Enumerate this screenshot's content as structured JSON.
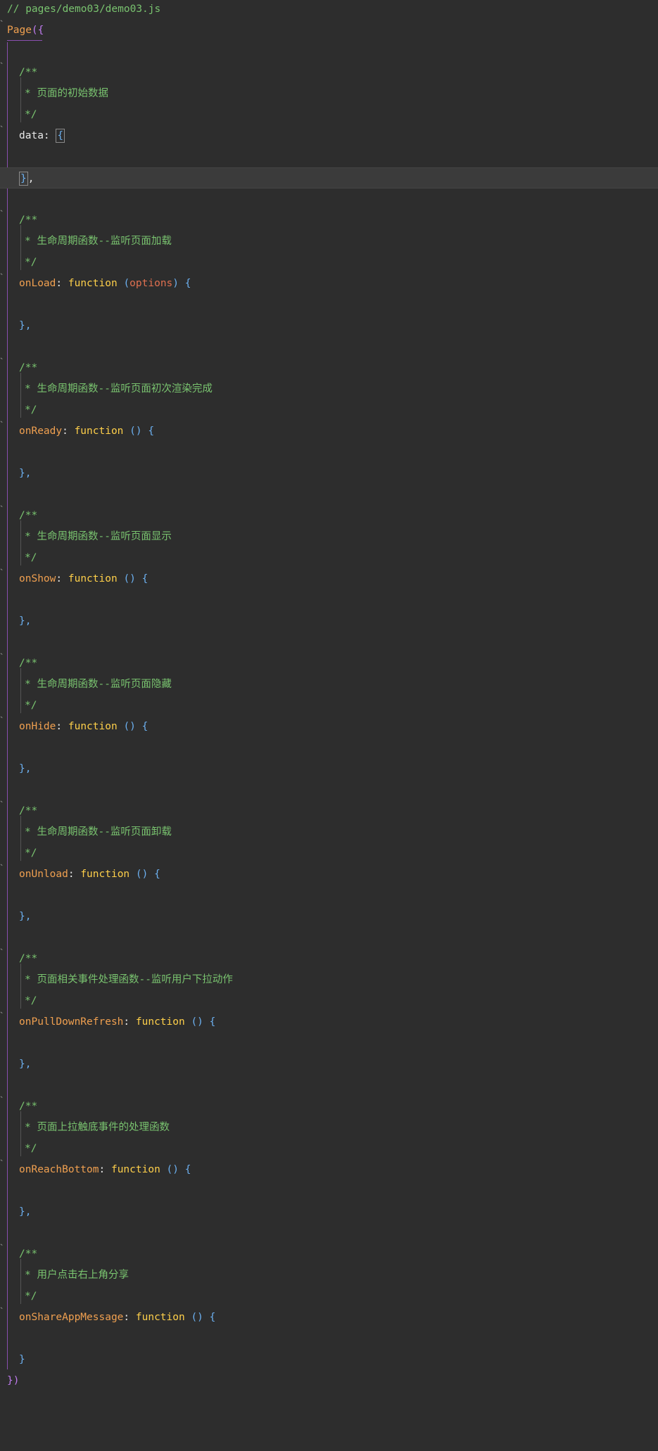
{
  "editor": {
    "file_comment": "// pages/demo03/demo03.js",
    "page_open": "Page",
    "open_paren": "(",
    "open_brace": "{",
    "close": "})",
    "comment_open": "/**",
    "comment_close": "*/",
    "data_label": "data",
    "colon": ":",
    "brace_open": "{",
    "brace_close": "}",
    "close_comma": "},",
    "closing_brace_only": "}",
    "function_kw": "function",
    "empty_params": "()",
    "options_param": "options",
    "comments": {
      "data": "* 页面的初始数据",
      "onLoad": "* 生命周期函数--监听页面加载",
      "onReady": "* 生命周期函数--监听页面初次渲染完成",
      "onShow": "* 生命周期函数--监听页面显示",
      "onHide": "* 生命周期函数--监听页面隐藏",
      "onUnload": "* 生命周期函数--监听页面卸载",
      "onPullDownRefresh": "* 页面相关事件处理函数--监听用户下拉动作",
      "onReachBottom": "* 页面上拉触底事件的处理函数",
      "onShareAppMessage": "* 用户点击右上角分享"
    },
    "methods": {
      "onLoad": "onLoad",
      "onReady": "onReady",
      "onShow": "onShow",
      "onHide": "onHide",
      "onUnload": "onUnload",
      "onPullDownRefresh": "onPullDownRefresh",
      "onReachBottom": "onReachBottom",
      "onShareAppMessage": "onShareAppMessage"
    }
  },
  "colors": {
    "background": "#2d2d2d",
    "comment": "#79c36f",
    "property": "#f0a050",
    "keyword": "#ffd04a",
    "paren": "#6cb0f0",
    "page_bracket": "#c07cf0",
    "param": "#e07050"
  }
}
